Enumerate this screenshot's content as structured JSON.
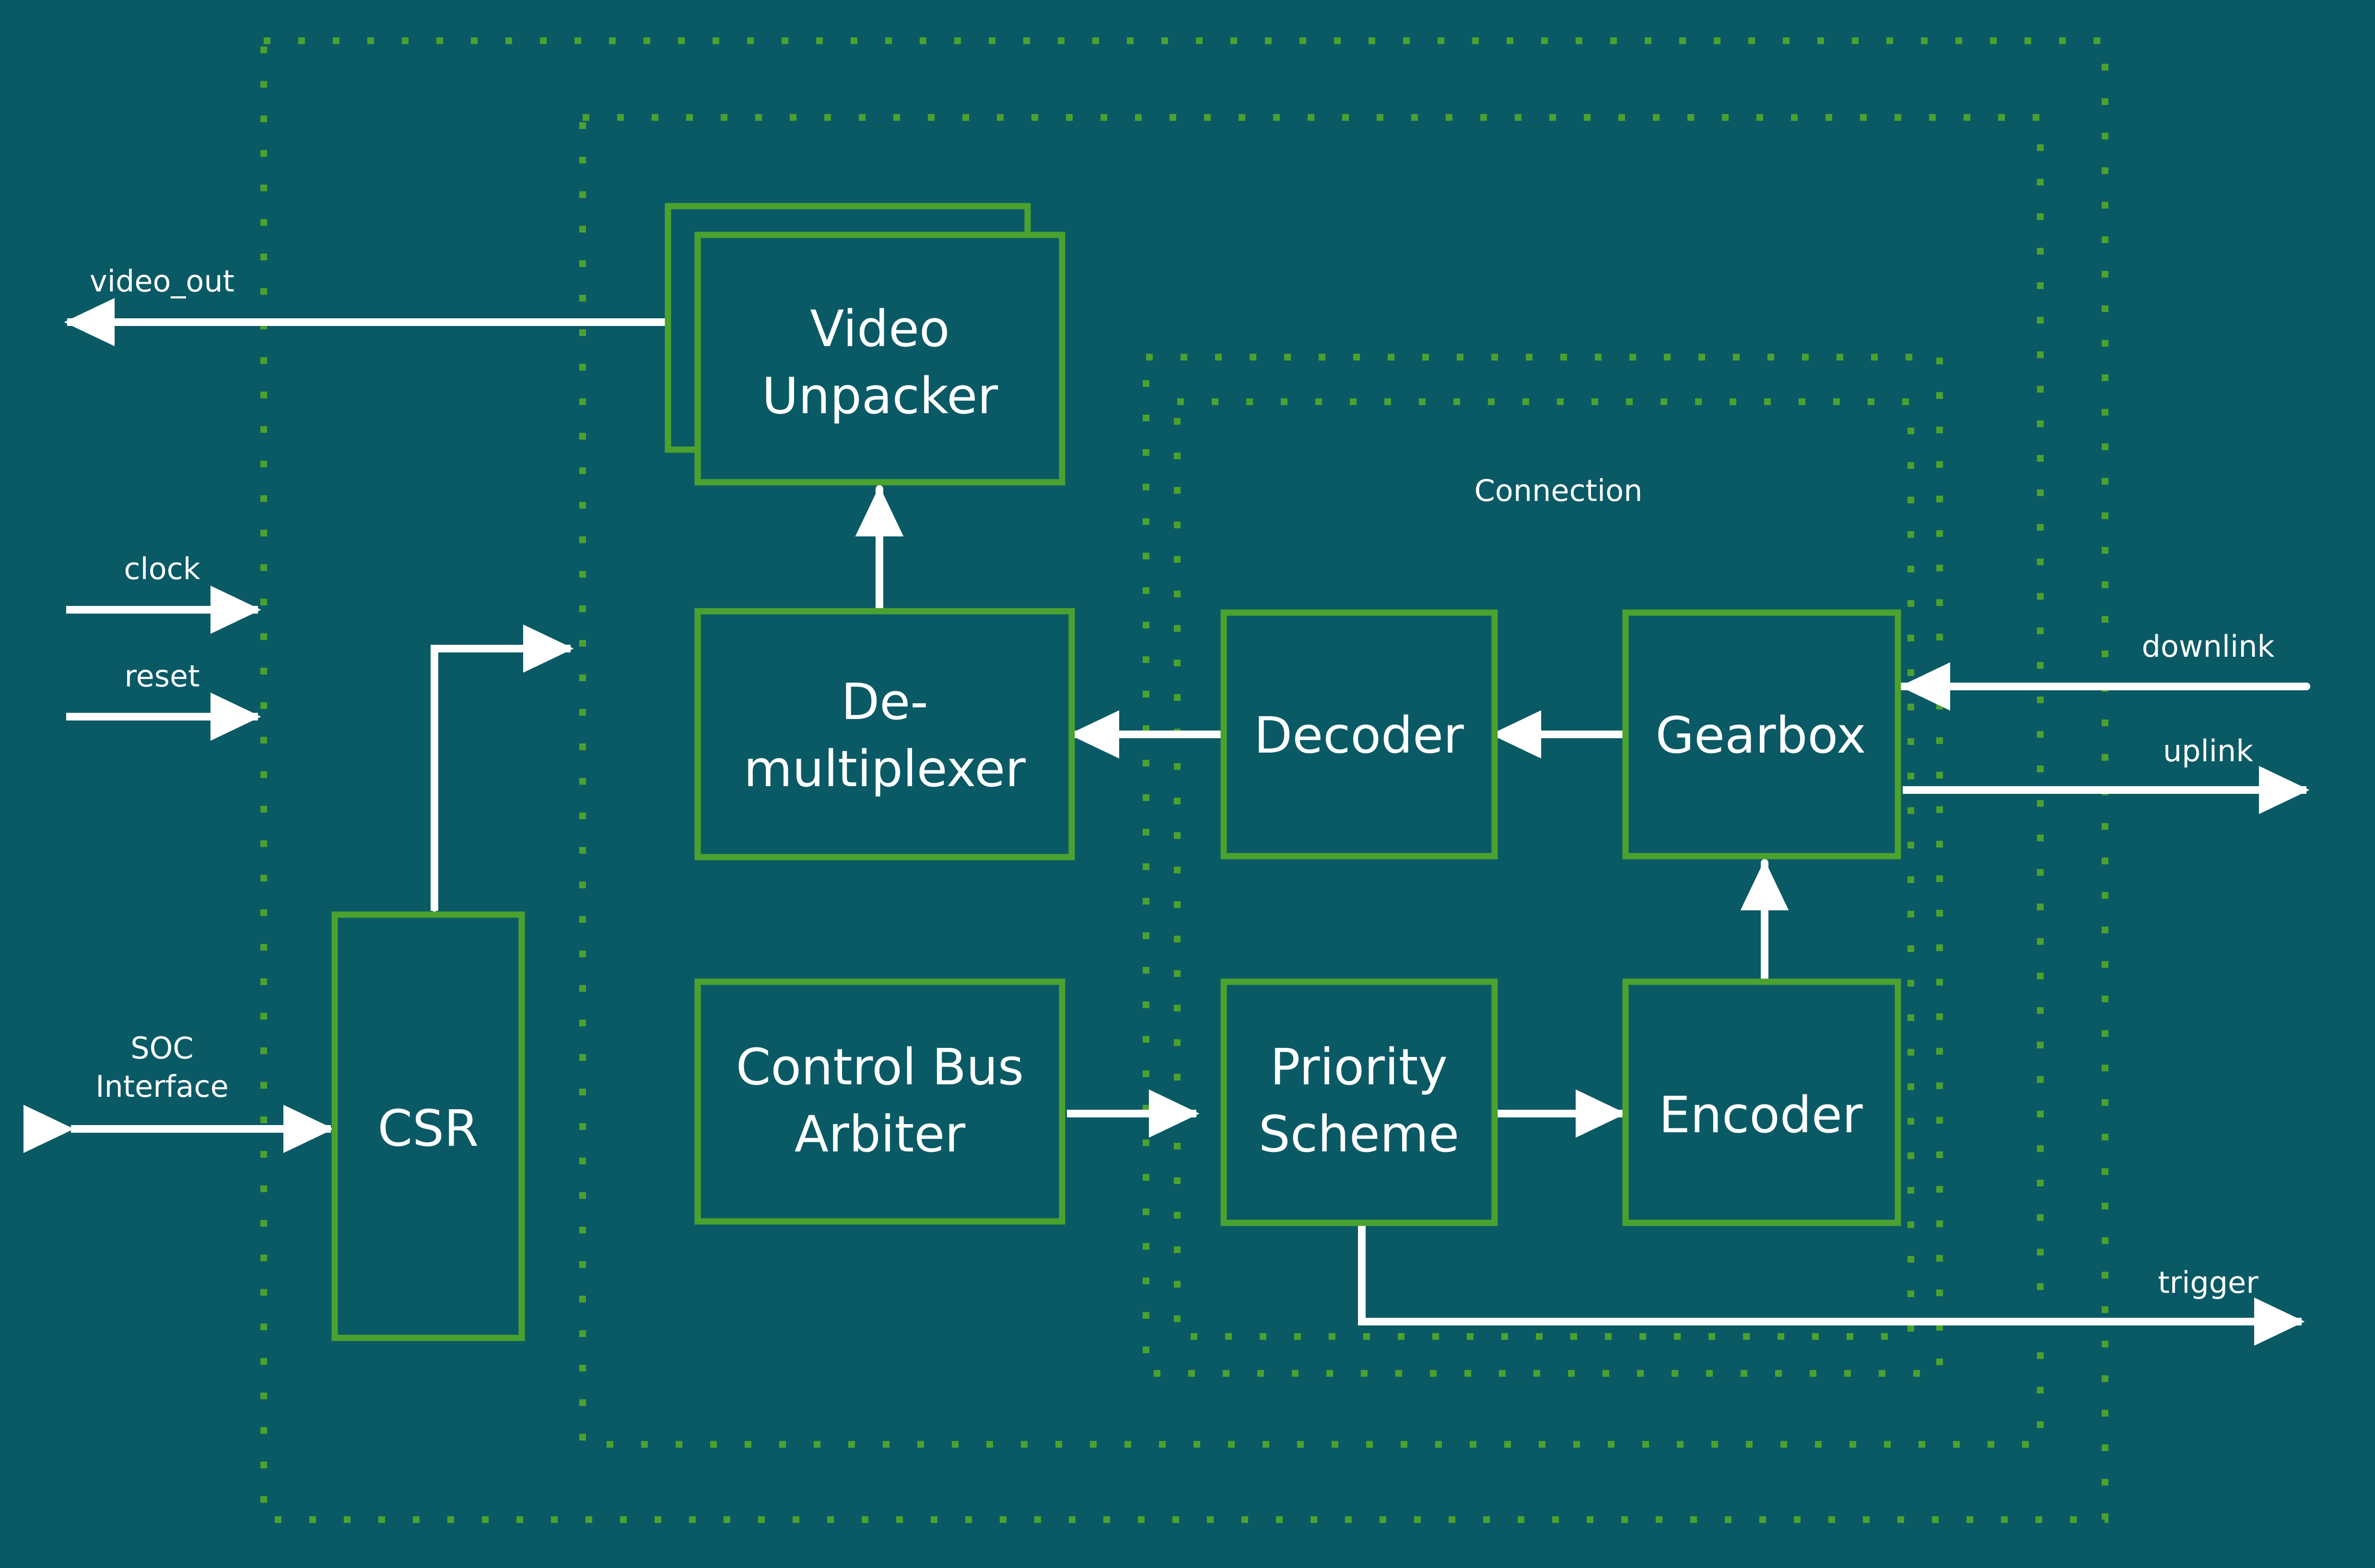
{
  "theme": {
    "background": "#0a5a66",
    "block_border": "#4ba22e",
    "group_border": "#4ba22e",
    "connector": "#ffffff",
    "text": "#ffffff"
  },
  "diagram": {
    "title": "Video link subsystem block diagram",
    "groups": [
      {
        "id": "outer",
        "label": ""
      },
      {
        "id": "middle",
        "label": ""
      },
      {
        "id": "connection_outer",
        "label": ""
      },
      {
        "id": "connection_inner",
        "label": "Connection"
      }
    ],
    "blocks": [
      {
        "id": "video_unpacker",
        "label_lines": [
          "Video",
          "Unpacker"
        ],
        "stacked": true
      },
      {
        "id": "demultiplexer",
        "label_lines": [
          "De-",
          "multiplexer"
        ],
        "stacked": false
      },
      {
        "id": "decoder",
        "label_lines": [
          "Decoder"
        ],
        "stacked": false
      },
      {
        "id": "gearbox",
        "label_lines": [
          "Gearbox"
        ],
        "stacked": false
      },
      {
        "id": "csr",
        "label_lines": [
          "CSR"
        ],
        "stacked": false
      },
      {
        "id": "control_bus_arbiter",
        "label_lines": [
          "Control Bus",
          "Arbiter"
        ],
        "stacked": false
      },
      {
        "id": "priority_scheme",
        "label_lines": [
          "Priority",
          "Scheme"
        ],
        "stacked": false
      },
      {
        "id": "encoder",
        "label_lines": [
          "Encoder"
        ],
        "stacked": false
      }
    ],
    "io_ports": [
      {
        "id": "video_out",
        "label": "video_out",
        "direction": "out",
        "side": "left"
      },
      {
        "id": "clock",
        "label": "clock",
        "direction": "in",
        "side": "left"
      },
      {
        "id": "reset",
        "label": "reset",
        "direction": "in",
        "side": "left"
      },
      {
        "id": "soc_interface",
        "label_lines": [
          "SOC",
          "Interface"
        ],
        "direction": "bidirectional",
        "side": "left"
      },
      {
        "id": "downlink",
        "label": "downlink",
        "direction": "in",
        "side": "right"
      },
      {
        "id": "uplink",
        "label": "uplink",
        "direction": "out",
        "side": "right"
      },
      {
        "id": "trigger",
        "label": "trigger",
        "direction": "out",
        "side": "right"
      }
    ],
    "connections": [
      {
        "from": "video_unpacker",
        "to": "video_out",
        "arrow": "single"
      },
      {
        "from": "demultiplexer",
        "to": "video_unpacker",
        "arrow": "single"
      },
      {
        "from": "decoder",
        "to": "demultiplexer",
        "arrow": "single"
      },
      {
        "from": "gearbox",
        "to": "decoder",
        "arrow": "single"
      },
      {
        "from": "downlink",
        "to": "gearbox",
        "arrow": "single"
      },
      {
        "from": "gearbox",
        "to": "uplink",
        "arrow": "single"
      },
      {
        "from": "encoder",
        "to": "gearbox",
        "arrow": "single"
      },
      {
        "from": "priority_scheme",
        "to": "encoder",
        "arrow": "single"
      },
      {
        "from": "control_bus_arbiter",
        "to": "priority_scheme",
        "arrow": "single"
      },
      {
        "from": "trigger",
        "to": "priority_scheme",
        "arrow": "single"
      },
      {
        "from": "soc_interface",
        "to": "csr",
        "arrow": "double"
      },
      {
        "from": "csr",
        "to": "middle_group",
        "arrow": "double"
      }
    ]
  },
  "labels": {
    "video_out": "video_out",
    "clock": "clock",
    "reset": "reset",
    "soc_line1": "SOC",
    "soc_line2": "Interface",
    "downlink": "downlink",
    "uplink": "uplink",
    "trigger": "trigger",
    "connection": "Connection",
    "video_unpacker_l1": "Video",
    "video_unpacker_l2": "Unpacker",
    "demux_l1": "De-",
    "demux_l2": "multiplexer",
    "decoder": "Decoder",
    "gearbox": "Gearbox",
    "csr": "CSR",
    "cba_l1": "Control Bus",
    "cba_l2": "Arbiter",
    "prio_l1": "Priority",
    "prio_l2": "Scheme",
    "encoder": "Encoder"
  }
}
